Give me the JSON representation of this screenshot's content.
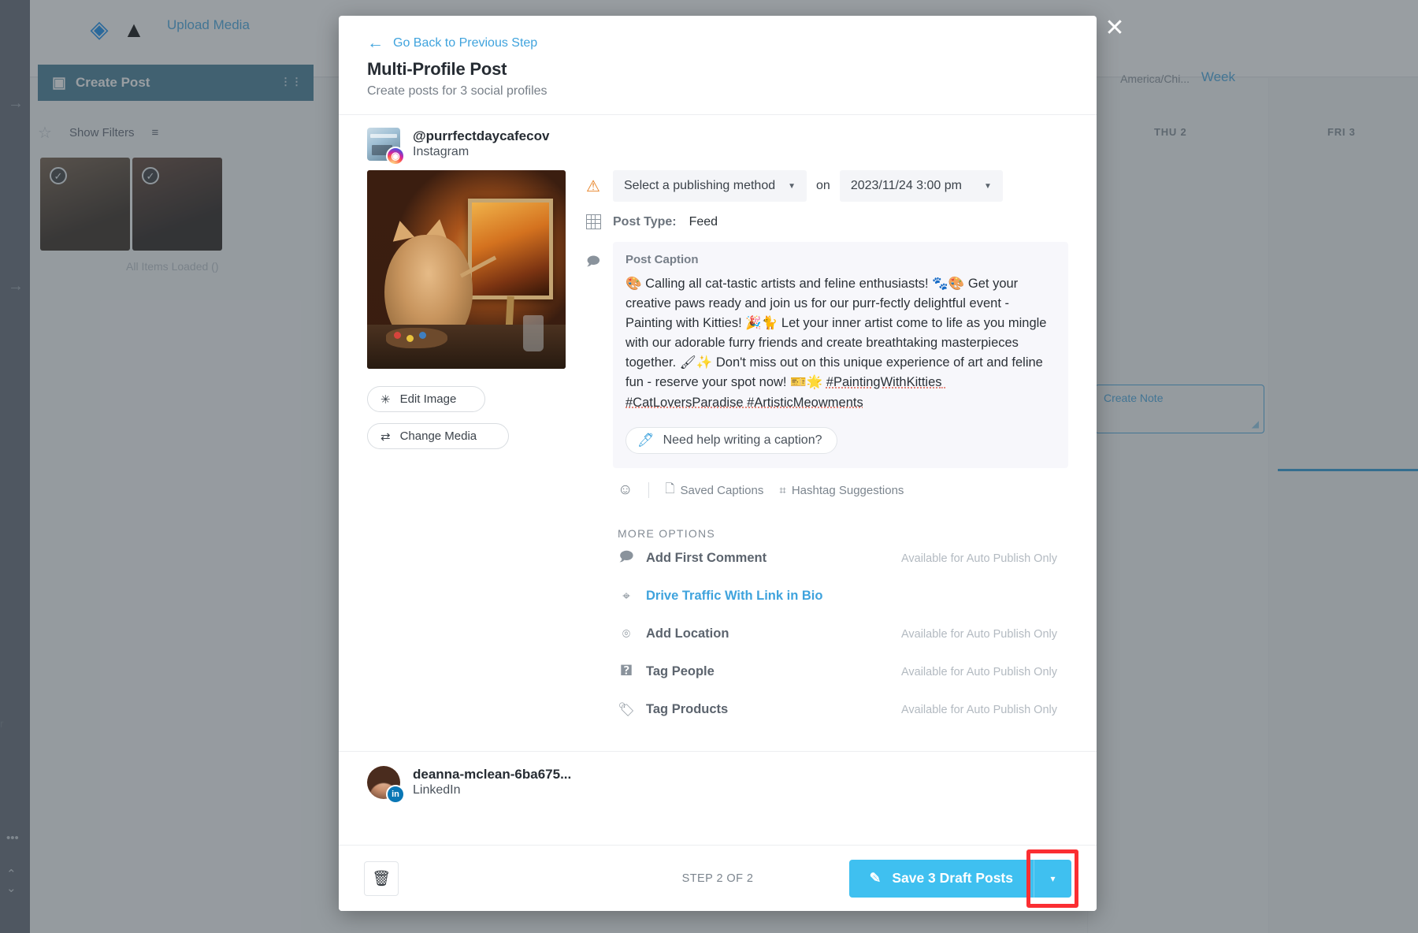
{
  "background": {
    "upload_media": "Upload Media",
    "create_post": "Create Post",
    "show_filters": "Show Filters",
    "all_items_loaded": "All Items Loaded ()",
    "timezone": "America/Chi...",
    "week": "Week",
    "day_thu": "THU 2",
    "day_fri": "FRI 3",
    "create_note": "Create Note",
    "icons": {
      "dropbox": "dropbox-icon",
      "gdrive": "google-drive-icon",
      "create_post": "create-post-icon",
      "star": "star-icon"
    }
  },
  "modal": {
    "close_label": "✕",
    "back_link": "Go Back to Previous Step",
    "title": "Multi-Profile Post",
    "subtitle": "Create posts for 3 social profiles"
  },
  "instagram_profile": {
    "handle": "@purrfectdaycafecov",
    "network": "Instagram",
    "badge_glyph": "◉"
  },
  "publishing": {
    "method_placeholder": "Select a publishing method",
    "on_label": "on",
    "datetime": "2023/11/24 3:00 pm",
    "warning_icon": "warning-triangle-icon"
  },
  "post_type": {
    "label": "Post Type:",
    "value": "Feed"
  },
  "caption": {
    "section_label": "Post Caption",
    "text": "🎨 Calling all cat-tastic artists and feline enthusiasts! 🐾🎨 Get your creative paws ready and join us for our purr-fectly delightful event - Painting with Kitties! 🎉🐈 Let your inner artist come to life as you mingle with our adorable furry friends and create breathtaking masterpieces together. 🖌✨ Don't miss out on this unique experience of art and feline fun - reserve your spot now! 🎫🌟 ",
    "hashtags": "#PaintingWithKitties #CatLoversParadise #ArtisticMeowments",
    "help_button": "Need help writing a caption?",
    "tools": [
      {
        "name": "emoji-picker",
        "icon": "☺",
        "label": ""
      },
      {
        "name": "saved-captions",
        "icon": "⎘",
        "label": "Saved Captions"
      },
      {
        "name": "hashtag-suggestions",
        "icon": "#",
        "label": "Hashtag Suggestions"
      }
    ]
  },
  "media_buttons": {
    "edit_image": "Edit Image",
    "change_media": "Change Media"
  },
  "more_options": {
    "title": "MORE OPTIONS",
    "items": [
      {
        "icon": "hash-comment-icon",
        "glyph": "⧉",
        "label": "Add First Comment",
        "note": "Available for Auto Publish Only",
        "is_link": false
      },
      {
        "icon": "link-bio-icon",
        "glyph": "☉",
        "label": "Drive Traffic With Link in Bio",
        "note": "",
        "is_link": true
      },
      {
        "icon": "location-pin-icon",
        "glyph": "◎",
        "label": "Add Location",
        "note": "Available for Auto Publish Only",
        "is_link": false
      },
      {
        "icon": "tag-people-icon",
        "glyph": "□",
        "label": "Tag People",
        "note": "Available for Auto Publish Only",
        "is_link": false
      },
      {
        "icon": "tag-products-icon",
        "glyph": "▽",
        "label": "Tag Products",
        "note": "Available for Auto Publish Only",
        "is_link": false
      }
    ]
  },
  "linkedin_profile": {
    "name": "deanna-mclean-6ba675...",
    "network": "LinkedIn",
    "badge_glyph": "in"
  },
  "footer": {
    "trash_icon": "🗑",
    "step_label": "STEP 2 OF 2",
    "save_label": "Save 3 Draft Posts",
    "save_caret": "▾",
    "pencil_icon": "pencil-icon"
  },
  "colors": {
    "accent_blue": "#3fc0f0",
    "link_blue": "#3fa3dd",
    "highlight_red": "#fb2e32",
    "warning_orange": "#e8852a"
  }
}
